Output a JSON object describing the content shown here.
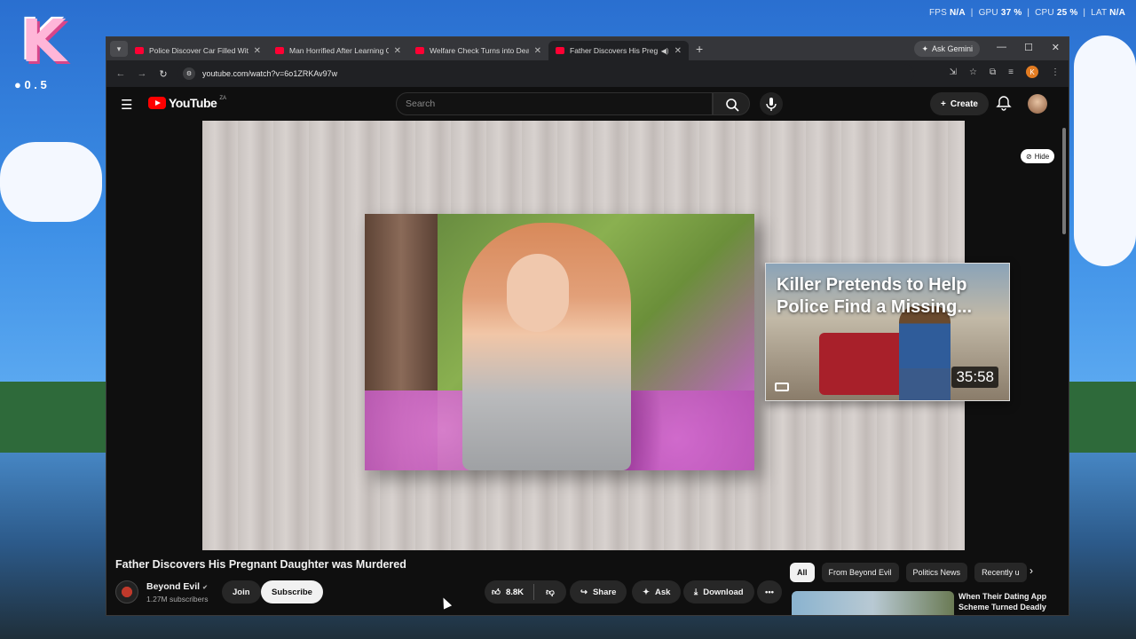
{
  "desktop": {
    "hud": {
      "logo_letter": "K",
      "dots": "● 0 . 5"
    },
    "perf": {
      "fps_label": "FPS",
      "fps_value": "N/A",
      "gpu_label": "GPU",
      "gpu_value": "37 %",
      "cpu_label": "CPU",
      "cpu_value": "25 %",
      "lat_label": "LAT",
      "lat_value": "N/A"
    }
  },
  "browser": {
    "tabs": [
      {
        "title": "Police Discover Car Filled With",
        "active": false
      },
      {
        "title": "Man Horrified After Learning G",
        "active": false
      },
      {
        "title": "Welfare Check Turns into Deadl",
        "active": false
      },
      {
        "title": "Father Discovers His Pregna",
        "active": true
      }
    ],
    "new_tab": "+",
    "gemini_label": "Ask Gemini",
    "url": "youtube.com/watch?v=6o1ZRKAv97w",
    "profile_letter": "K"
  },
  "youtube": {
    "logo_word": "YouTube",
    "country": "ZA",
    "search_placeholder": "Search",
    "create_label": "Create",
    "hide_label": "Hide",
    "endcard": {
      "title_line1": "Killer Pretends to Help",
      "title_line2": "Police Find a Missing...",
      "duration": "35:58"
    },
    "video": {
      "title": "Father Discovers His Pregnant Daughter was Murdered",
      "channel": "Beyond Evil",
      "subscribers": "1.27M subscribers",
      "join_label": "Join",
      "subscribe_label": "Subscribe",
      "likes": "8.8K",
      "share_label": "Share",
      "ask_label": "Ask",
      "download_label": "Download"
    },
    "chips": [
      "All",
      "From Beyond Evil",
      "Politics News",
      "Recently u"
    ],
    "recommended": {
      "title": "When Their Dating App Scheme Turned Deadly"
    }
  }
}
